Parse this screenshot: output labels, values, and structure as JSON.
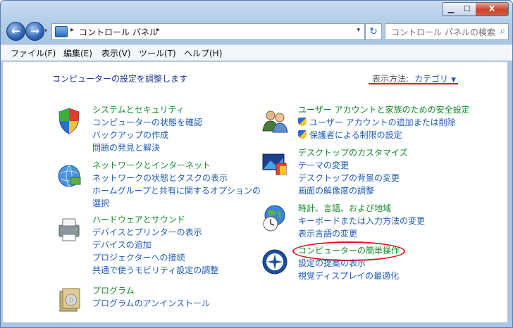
{
  "window": {
    "min_glyph": "▁",
    "max_glyph": "☐",
    "close_glyph": "X"
  },
  "nav": {
    "back_glyph": "←",
    "forward_glyph": "→",
    "dropdown_glyph": "▾"
  },
  "address": {
    "crumb": "コントロール パネル",
    "separator": "▸",
    "dropdown_glyph": "▾"
  },
  "search": {
    "placeholder": "コントロール パネルの検索",
    "icon": "search-icon",
    "glyph": "⌕"
  },
  "refresh_glyph": "↻",
  "menu": {
    "file": "ファイル(F)",
    "edit": "編集(E)",
    "view": "表示(V)",
    "tools": "ツール(T)",
    "help": "ヘルプ(H)"
  },
  "main": {
    "heading": "コンピューターの設定を調整します",
    "view_by_label": "表示方法:",
    "view_by_value": "カテゴリ",
    "view_by_arrow": "▼"
  },
  "categories": {
    "system": {
      "title": "システムとセキュリティ",
      "links": [
        "コンピューターの状態を確認",
        "バックアップの作成",
        "問題の発見と解決"
      ]
    },
    "network": {
      "title": "ネットワークとインターネット",
      "links": [
        "ネットワークの状態とタスクの表示",
        "ホームグループと共有に関するオプションの",
        "選択"
      ]
    },
    "hardware": {
      "title": "ハードウェアとサウンド",
      "links": [
        "デバイスとプリンターの表示",
        "デバイスの追加",
        "プロジェクターへの接続",
        "共通で使うモビリティ設定の調整"
      ]
    },
    "programs": {
      "title": "プログラム",
      "links": [
        "プログラムのアンインストール"
      ]
    },
    "users": {
      "title": "ユーザー アカウントと家族のための安全設定",
      "links": [
        "ユーザー アカウントの追加または削除",
        "保護者による制限の設定"
      ]
    },
    "appearance": {
      "title": "デスクトップのカスタマイズ",
      "links": [
        "テーマの変更",
        "デスクトップの背景の変更",
        "画面の解像度の調整"
      ]
    },
    "clock": {
      "title": "時計、言語、および地域",
      "links": [
        "キーボードまたは入力方法の変更",
        "表示言語の変更"
      ]
    },
    "ease": {
      "title": "コンピューターの簡単操作",
      "links": [
        "設定の提案の表示",
        "視覚ディスプレイの最適化"
      ]
    }
  },
  "colors": {
    "category_title": "#138a2c",
    "link": "#1e5bb8",
    "highlight": "#e1141a"
  }
}
